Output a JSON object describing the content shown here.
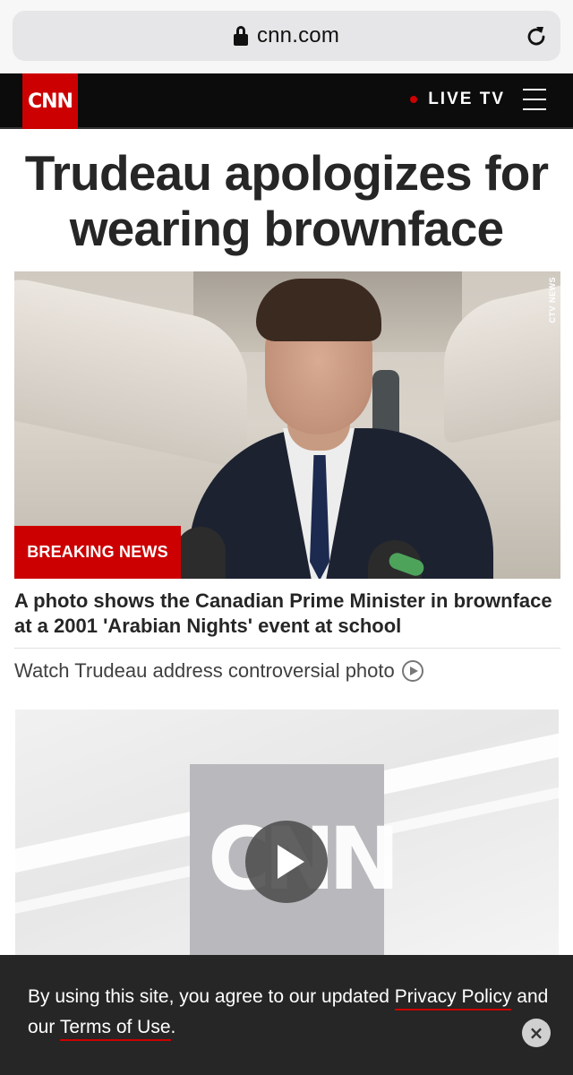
{
  "browser": {
    "url": "cnn.com",
    "lock_icon": "lock-icon",
    "reload_icon": "reload-icon"
  },
  "header": {
    "logo_text": "CNN",
    "live_tv_label": "LIVE TV",
    "menu_icon": "hamburger-menu-icon",
    "brand_color": "#cc0000",
    "background_color": "#0c0c0c"
  },
  "article": {
    "headline": "Trudeau apologizes for wearing brownface",
    "image_credit": "CTV NEWS",
    "badge": "BREAKING NEWS",
    "description": "A photo shows the Canadian Prime Minister in brownface at a 2001 'Arabian Nights' event at school",
    "watch_link": "Watch Trudeau address controversial photo",
    "watch_icon": "play-circle-icon"
  },
  "video": {
    "thumb_logo": "CNN",
    "play_icon": "play-icon"
  },
  "cookie_banner": {
    "text_before": "By using this site, you agree to our updated ",
    "privacy_link": "Privacy Policy",
    "text_middle": " and our ",
    "terms_link": "Terms of Use",
    "text_after": ".",
    "close_label": "×"
  }
}
